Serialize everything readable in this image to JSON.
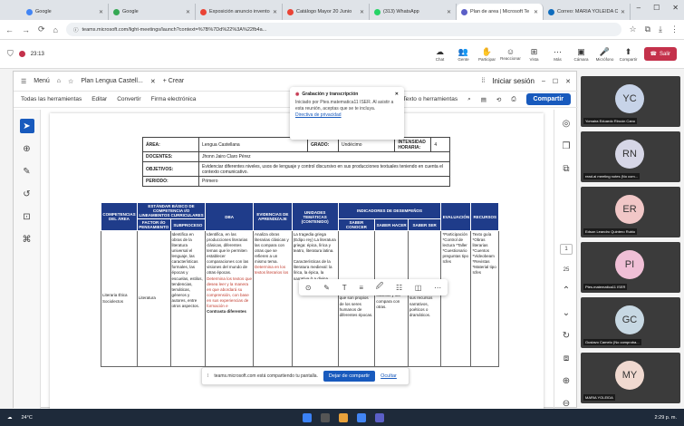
{
  "browser": {
    "tabs": [
      {
        "title": "Google",
        "color": "#4285f4"
      },
      {
        "title": "Google",
        "color": "#34a853"
      },
      {
        "title": "Exposición anuncio invento",
        "color": "#ea4335"
      },
      {
        "title": "Catálogo Mayor 20 Junio",
        "color": "#ea4335"
      },
      {
        "title": "(313) WhatsApp",
        "color": "#25d366"
      },
      {
        "title": "Plan de area | Microsoft Te",
        "color": "#5b5fc7",
        "active": true
      },
      {
        "title": "Correo: MARIA YOLEIDA CANS",
        "color": "#0f6cbd"
      }
    ],
    "url": "teams.microsoft.com/light-meetings/launch?context=%7B%7Dd%22%3A%22fb4a...",
    "window_controls": [
      "–",
      "☐",
      "✕"
    ]
  },
  "teams": {
    "timer": "23:13",
    "controls": [
      {
        "label": "Chat",
        "icon": "☁"
      },
      {
        "label": "Gente",
        "icon": "👥"
      },
      {
        "label": "Participar",
        "icon": "✋"
      },
      {
        "label": "Reaccionar",
        "icon": "☺"
      },
      {
        "label": "Vista",
        "icon": "⊞"
      },
      {
        "label": "Más",
        "icon": "⋯"
      },
      {
        "label": "Cámara",
        "icon": "▣"
      },
      {
        "label": "Micrófono",
        "icon": "🎤"
      },
      {
        "label": "Compartir",
        "icon": "⬆"
      }
    ],
    "leave_label": "Salir"
  },
  "word": {
    "menu_label": "Menú",
    "doc_title": "Plan Lengua Castell...",
    "new_label": "+ Crear",
    "signin": "Iniciar sesión",
    "ribbon": [
      "Todas las herramientas",
      "Editar",
      "Convertir",
      "Firma electrónica"
    ],
    "ribbon_right": "Texto o herramientas",
    "share": "Compartir"
  },
  "meta": [
    {
      "k": "ÁREA:",
      "v": "Lengua Castellana",
      "k2": "GRADO:",
      "v2": "Undécimo",
      "k3": "INTENSIDAD HORARIA:",
      "v3": "4"
    },
    {
      "k": "DOCENTES:",
      "v": "Jhonn Jairo Claro Pérez"
    },
    {
      "k": "OBJETIVOS:",
      "v": "Evidenciar diferentes niveles, usos de lenguaje y control discursivo en sus producciones textuales teniendo en cuenta el contexto comunicativo."
    },
    {
      "k": "PERIODO:",
      "v": "Primero"
    }
  ],
  "plan": {
    "headers": {
      "competencias": "COMPETENCIAS DEL ÁREA",
      "estandar": "ESTÁNDAR BÁSICO DE COMPETENCIA I/O LINEAMIENTOS CURRICULARES",
      "factor": "FACTOR I/O PENSAMIENTO",
      "subproceso": "SUBPROCESO",
      "dba": "DBA",
      "evidencias": "EVIDENCIAS DE APRENDIZAJE",
      "unidades": "UNIDADES TEMÁTICAS (CONTENIDO)",
      "indicadores": "INDICADORES DE DESEMPEÑOS",
      "saber_conocer": "SABER CONOCER",
      "saber_hacer": "SABER HACER",
      "saber_ser": "SABER SER",
      "evaluacion": "EVALUACIÓN",
      "recursos": "RECURSOS"
    },
    "row": {
      "competencias": "Literaria Ética Sociolectos",
      "factor": "Literatura",
      "subproceso": "Identifica en obras de la literatura universal el lenguaje, las características formales, las épocas y escuelas, estilos, tendencias, temáticas, géneros y autores, entre otros aspectos.",
      "dba": "Identifica, en las producciones literarias clásicas, diferentes temas que le permiten establecer comparaciones con las visiones del mundo de otras épocas.",
      "dba_red": "Determina los textos que desea leer y la manera en que abordará su comprensión, con base en sus experiencias de formación e",
      "dba_tail": "Contrasta diferentes",
      "evidencias": "Analiza obras literarias clásicas y las compara con otras que se refieren a un mismo tema.",
      "evidencias_red": "Determina en los textos literarios los",
      "unidades": "La tragedia griega (Edipo rey) La literatura griega: épica, lírica y teatro, literatura latina.",
      "unidades_tail": "Características de la literatura medieval: la lírica, la épica, la narrativa (La divina",
      "saber_conocer": "Reconoce que en los obras clásicas se abordan temas que son propios de los seres humanos de diferentes épocas.",
      "saber_hacer": "Analiza obras clásicas y las compara con otras.",
      "saber_ser": "Valora las obras clásicas está determinada por sus recursos narrativos, poéticos o dramáticos.",
      "evaluacion": "*Participación *Control de lectura *Taller *Cuestionario preguntas tipo Icfes",
      "recursos": "Texto guía *Obras literarias *Cuentos *Videobeam *Revistas *Material tipo Icfes"
    }
  },
  "popups": {
    "rec_title": "Grabación y transcripción",
    "rec_text": "Iniciado por Ptes.matematica11 ISER. Al asistir a esta reunión, aceptas que se te incluya.",
    "rec_link": "Directiva de privacidad",
    "format_icons": [
      "⊙",
      "✎",
      "T",
      "≡",
      "🖉",
      "☷",
      "◫",
      "⋯"
    ],
    "share_text": "teams.microsoft.com está compartiendo tu pantalla.",
    "stop_share": "Dejar de compartir",
    "hide": "Ocultar"
  },
  "page_num": "1",
  "page_total": "25",
  "participants": [
    {
      "initials": "YC",
      "name": "Yomaira Eduardo Rincón Cano",
      "color": "#c7d3e8"
    },
    {
      "initials": "RN",
      "name": "read.ai meeting notes (No com...",
      "color": "#d6d6e6"
    },
    {
      "initials": "ER",
      "name": "Edson Leandro Quintero Rubio",
      "color": "#f1c7c7"
    },
    {
      "initials": "PI",
      "name": "Ptes.matematica11 ISER",
      "color": "#f0bfd6"
    },
    {
      "initials": "GC",
      "name": "Gustavo Camelo (No comproba...",
      "color": "#c7d8e3"
    },
    {
      "initials": "MY",
      "name": "MARIA YOLEIDA",
      "color": "#f0d9d0"
    }
  ],
  "taskbar": {
    "weather": "24°C",
    "time": "2:29 p. m."
  }
}
